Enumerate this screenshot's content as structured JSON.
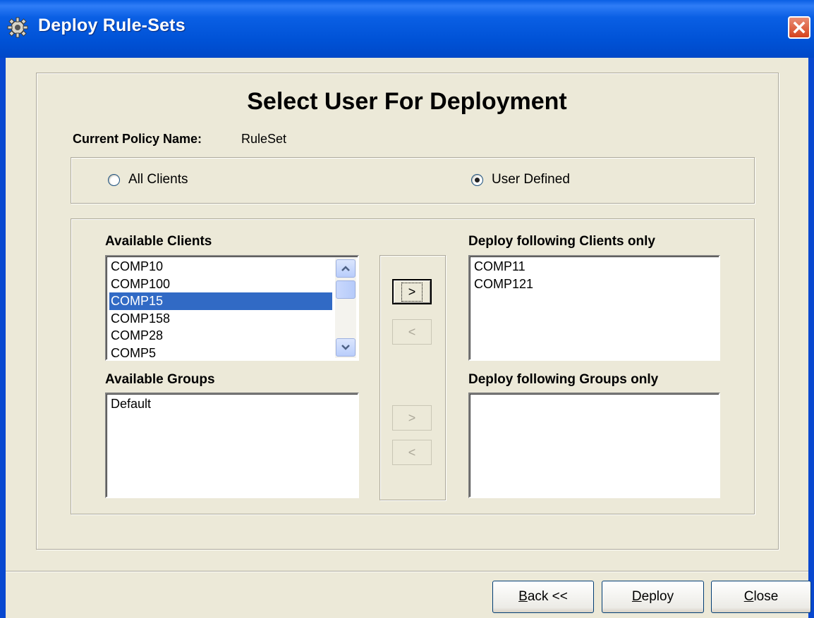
{
  "window": {
    "title": "Deploy Rule-Sets",
    "icon": "gear-icon",
    "close_icon": "close-icon"
  },
  "heading": "Select User For Deployment",
  "policy": {
    "label": "Current Policy Name:",
    "value": "RuleSet"
  },
  "scope": {
    "options": [
      {
        "label": "All Clients",
        "checked": false
      },
      {
        "label": "User Defined",
        "checked": true
      }
    ]
  },
  "available_clients": {
    "label": "Available Clients",
    "items": [
      "COMP10",
      "COMP100",
      "COMP15",
      "COMP158",
      "COMP28",
      "COMP5"
    ],
    "selected": "COMP15"
  },
  "available_groups": {
    "label": "Available Groups",
    "items": [
      "Default"
    ]
  },
  "deploy_clients": {
    "label": "Deploy following Clients only",
    "items": [
      "COMP11",
      "COMP121"
    ]
  },
  "deploy_groups": {
    "label": "Deploy following Groups only",
    "items": []
  },
  "move_buttons": {
    "add_client": ">",
    "remove_client": "<",
    "add_group": ">",
    "remove_group": "<"
  },
  "footer": {
    "back": {
      "mnemonic": "B",
      "rest": "ack <<"
    },
    "deploy": {
      "mnemonic": "D",
      "rest": "eploy"
    },
    "close": {
      "mnemonic": "C",
      "rest": "lose"
    }
  },
  "colors": {
    "titlebar": "#0a5fe4",
    "selection": "#316ac5",
    "dialog_bg": "#ece9d8"
  }
}
